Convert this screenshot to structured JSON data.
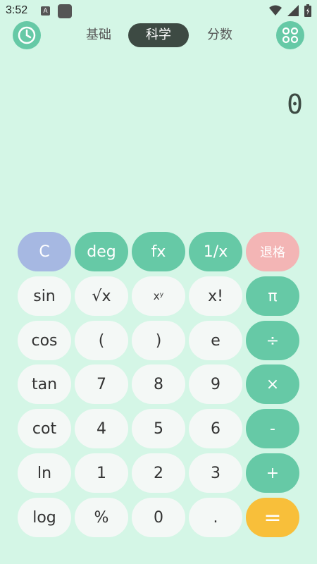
{
  "status_bar": {
    "time": "3:52",
    "badge": "A"
  },
  "tabs": [
    {
      "label": "基础",
      "active": false
    },
    {
      "label": "科学",
      "active": true
    },
    {
      "label": "分数",
      "active": false
    }
  ],
  "header": {
    "left_icon": "history-clock-icon",
    "right_icon": "grid-menu-icon"
  },
  "display": {
    "value": "0"
  },
  "keypad": {
    "rows": [
      [
        "C",
        "deg",
        "fx",
        "1/x",
        "退格"
      ],
      [
        "sin",
        "√x",
        "xʸ",
        "x!",
        "π"
      ],
      [
        "cos",
        "(",
        ")",
        "e",
        "÷"
      ],
      [
        "tan",
        "7",
        "8",
        "9",
        "×"
      ],
      [
        "cot",
        "4",
        "5",
        "6",
        "-"
      ],
      [
        "ln",
        "1",
        "2",
        "3",
        "+"
      ],
      [
        "log",
        "%",
        "0",
        ".",
        "="
      ]
    ]
  },
  "colors": {
    "background": "#d4f6e6",
    "accent": "#66c9a6",
    "clear": "#a6b8e2",
    "backspace": "#f3b5b5",
    "equals": "#f8bf3a",
    "tab_active": "#3d4a43"
  }
}
